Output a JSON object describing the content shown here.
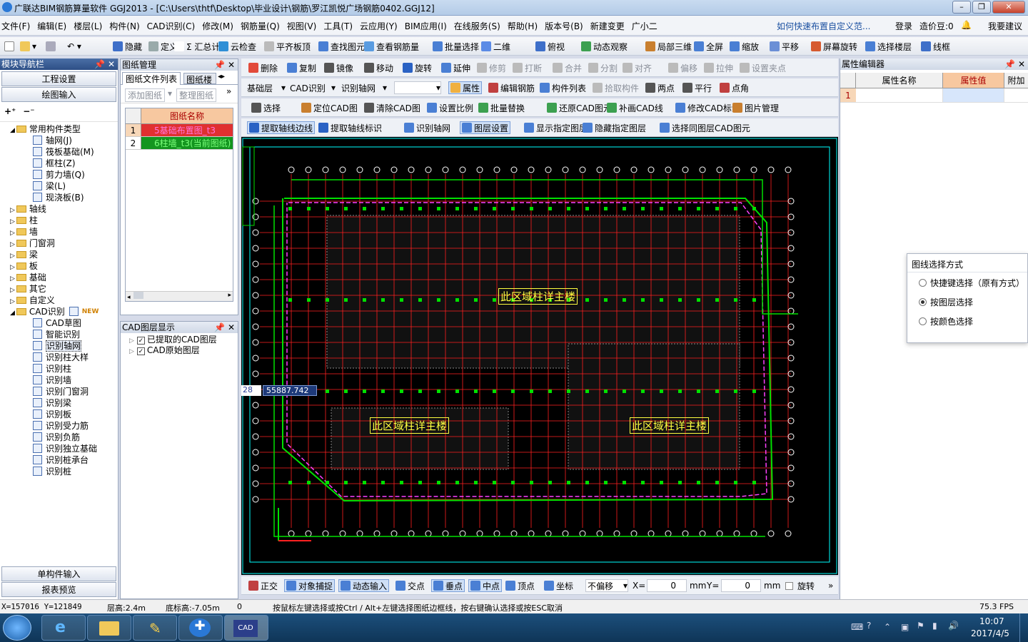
{
  "window": {
    "title": "广联达BIM钢筋算量软件 GGJ2013 - [C:\\Users\\thtf\\Desktop\\毕业设计\\钢筋\\罗江凯悦广场钢筋0402.GGJ12]"
  },
  "menu": [
    "文件(F)",
    "编辑(E)",
    "楼层(L)",
    "构件(N)",
    "CAD识别(C)",
    "修改(M)",
    "钢筋量(Q)",
    "视图(V)",
    "工具(T)",
    "云应用(Y)",
    "BIM应用(I)",
    "在线服务(S)",
    "帮助(H)",
    "版本号(B)",
    "新建变更",
    "广小二"
  ],
  "menu_right": {
    "help_link": "如何快速布置自定义范...",
    "login": "登录",
    "cost": "造价豆:0",
    "suggest": "我要建议"
  },
  "toolbar1": [
    "隐藏",
    "定义",
    "Σ 汇总计算",
    "云检查",
    "平齐板顶",
    "查找图元",
    "查看钢筋量",
    "批量选择",
    "二维",
    "俯视",
    "动态观察",
    "局部三维",
    "全屏",
    "缩放",
    "平移",
    "屏幕旋转",
    "选择楼层",
    "线框"
  ],
  "toolbar2": [
    "删除",
    "复制",
    "镜像",
    "移动",
    "旋转",
    "延伸",
    "修剪",
    "打断",
    "合并",
    "分割",
    "对齐",
    "偏移",
    "拉伸",
    "设置夹点"
  ],
  "toolbar3": {
    "floor": "基础层",
    "cad": "CAD识别",
    "axis": "识别轴网",
    "items": [
      "属性",
      "编辑钢筋",
      "构件列表",
      "拾取构件",
      "两点",
      "平行",
      "点角"
    ]
  },
  "toolbar4": [
    "选择",
    "定位CAD图",
    "清除CAD图",
    "设置比例",
    "批量替换",
    "还原CAD图元",
    "补画CAD线",
    "修改CAD标注",
    "图片管理"
  ],
  "toolbar5": [
    "提取轴线边线",
    "提取轴线标识",
    "识别轴网",
    "图层设置",
    "显示指定图层",
    "隐藏指定图层",
    "选择同图层CAD图元"
  ],
  "nav": {
    "title": "模块导航栏",
    "btn1": "工程设置",
    "btn2": "绘图输入",
    "tree_root": "常用构件类型",
    "common": [
      "轴网(J)",
      "筏板基础(M)",
      "框柱(Z)",
      "剪力墙(Q)",
      "梁(L)",
      "现浇板(B)"
    ],
    "folders": [
      "轴线",
      "柱",
      "墙",
      "门窗洞",
      "梁",
      "板",
      "基础",
      "其它",
      "自定义"
    ],
    "cad_folder": "CAD识别",
    "new_badge": "NEW",
    "cad_items": [
      "CAD草图",
      "智能识别",
      "识别轴网",
      "识别柱大样",
      "识别柱",
      "识别墙",
      "识别门窗洞",
      "识别梁",
      "识别板",
      "识别受力筋",
      "识别负筋",
      "识别独立基础",
      "识别桩承台",
      "识别桩"
    ],
    "bottom1": "单构件输入",
    "bottom2": "报表预览"
  },
  "drawings": {
    "title": "图纸管理",
    "tabs": [
      "图纸文件列表",
      "图纸楼"
    ],
    "buttons": [
      "添加图纸",
      "整理图纸"
    ],
    "col": "图纸名称",
    "rows": [
      {
        "n": "1",
        "name": "5基础布置图_t3"
      },
      {
        "n": "2",
        "name": "6柱墙_t3(当前图纸)"
      }
    ]
  },
  "layers": {
    "title": "CAD图层显示",
    "items": [
      "已提取的CAD图层",
      "CAD原始图层"
    ]
  },
  "props": {
    "title": "属性编辑器",
    "cols": [
      "属性名称",
      "属性值",
      "附加"
    ],
    "row": "1"
  },
  "popup": {
    "title": "图线选择方式",
    "options": [
      "快捷键选择（原有方式）",
      "按图层选择",
      "按颜色选择"
    ],
    "selected": 1
  },
  "canvas": {
    "labels": [
      "此区域柱详主楼",
      "此区域柱详主楼",
      "此区域柱详主楼"
    ],
    "coord_input": "55887.742",
    "coord_left": "28"
  },
  "snapbar": {
    "items": [
      "正交",
      "对象捕捉",
      "动态输入",
      "交点",
      "垂点",
      "中点",
      "顶点",
      "坐标"
    ],
    "offset": "不偏移",
    "x_label": "X=",
    "x_val": "0",
    "y_label": "Y=",
    "y_val": "0",
    "unit": "mm",
    "rotate": "旋转"
  },
  "status": {
    "coords": "X=157016  Y=121849",
    "floor_h": "层高:2.4m",
    "bottom_h": "底标高:-7.05m",
    "zero": "0",
    "hint": "按鼠标左键选择或按Ctrl / Alt+左键选择图纸边框线，按右键确认选择或按ESC取消",
    "fps": "75.3 FPS"
  },
  "clock": {
    "time": "10:07",
    "date": "2017/4/5"
  },
  "colors": {
    "grid_green": "#00e000",
    "axis_red": "#ff2020",
    "label_yellow": "#ffff40",
    "bubble": "#ffffff"
  }
}
